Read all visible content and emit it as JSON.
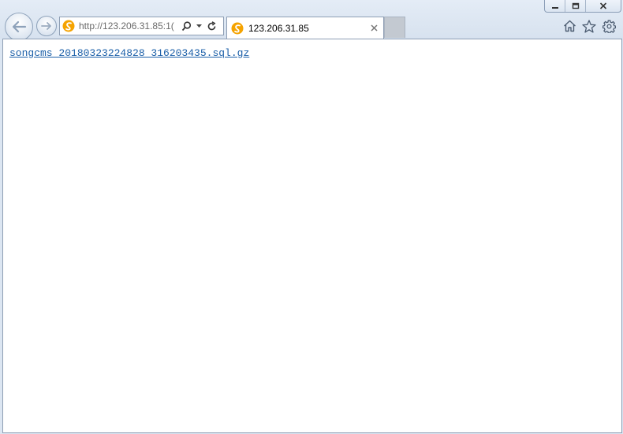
{
  "browser": {
    "address_bar": {
      "url": "http://123.206.31.85:1("
    },
    "tab": {
      "title": "123.206.31.85",
      "close_glyph": "×"
    },
    "icons": {
      "back": "back-arrow-icon",
      "forward": "forward-arrow-icon",
      "favicon": "site-favicon-icon",
      "search": "search-icon",
      "dropdown": "chevron-down-icon",
      "refresh": "refresh-icon",
      "home": "home-icon",
      "favorites": "star-icon",
      "settings": "gear-icon",
      "minimize": "minimize-icon",
      "restore": "restore-icon",
      "close": "close-icon"
    },
    "colors": {
      "link": "#1b5fa8",
      "favicon": "#f5a300",
      "chrome": "#dce6f2"
    }
  },
  "page": {
    "links": [
      {
        "text": "songcms_20180323224828_316203435.sql.gz"
      }
    ]
  }
}
